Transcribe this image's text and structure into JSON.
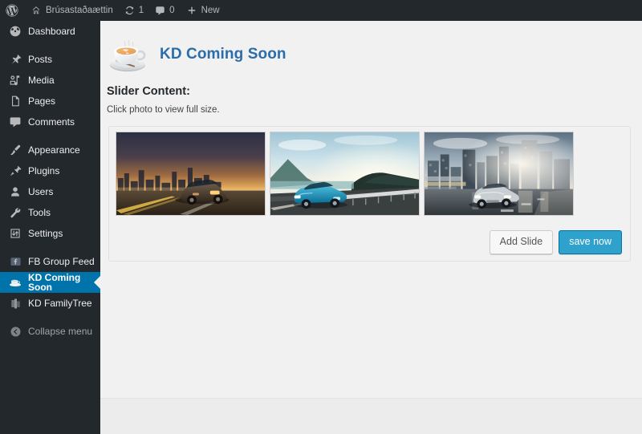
{
  "adminbar": {
    "logo_icon": "wordpress-logo-icon",
    "site_home_icon": "home-icon",
    "site_name": "Brúsastaðaættin",
    "updates_icon": "updates-refresh-icon",
    "updates_count": "1",
    "comments_icon": "comment-bubble-icon",
    "comments_count": "0",
    "new_icon": "plus-icon",
    "new_label": "New"
  },
  "sidebar": {
    "items": [
      {
        "label": "Dashboard",
        "icon": "dashboard-icon",
        "current": false,
        "sep_after": true
      },
      {
        "label": "Posts",
        "icon": "pin-icon",
        "current": false,
        "sep_after": false
      },
      {
        "label": "Media",
        "icon": "media-icon",
        "current": false,
        "sep_after": false
      },
      {
        "label": "Pages",
        "icon": "pages-icon",
        "current": false,
        "sep_after": false
      },
      {
        "label": "Comments",
        "icon": "comment-icon",
        "current": false,
        "sep_after": true
      },
      {
        "label": "Appearance",
        "icon": "paintbrush-icon",
        "current": false,
        "sep_after": false
      },
      {
        "label": "Plugins",
        "icon": "plug-icon",
        "current": false,
        "sep_after": false
      },
      {
        "label": "Users",
        "icon": "user-icon",
        "current": false,
        "sep_after": false
      },
      {
        "label": "Tools",
        "icon": "wrench-icon",
        "current": false,
        "sep_after": false
      },
      {
        "label": "Settings",
        "icon": "settings-icon",
        "current": false,
        "sep_after": true
      },
      {
        "label": "FB Group Feed",
        "icon": "facebook-feed-icon",
        "current": false,
        "sep_after": false
      },
      {
        "label": "KD Coming Soon",
        "icon": "coffee-cup-icon",
        "current": true,
        "sep_after": false
      },
      {
        "label": "KD FamilyTree",
        "icon": "family-tree-icon",
        "current": false,
        "sep_after": false
      }
    ],
    "collapse_label": "Collapse menu",
    "collapse_icon": "collapse-arrow-icon"
  },
  "page": {
    "logo_icon": "coffee-cup-logo-icon",
    "title": "KD Coming Soon",
    "section_heading": "Slider Content:",
    "section_subtext": "Click photo to view full size."
  },
  "slider": {
    "slides": [
      {
        "name": "slide-1",
        "alt": "Brown SUV driving on highway with city skyline at sunset"
      },
      {
        "name": "slide-2",
        "alt": "Blue sports sedan on coastal mountain road at sunrise"
      },
      {
        "name": "slide-3",
        "alt": "Silver sedan on wet city street with skyscrapers and sun flare"
      }
    ],
    "add_slide_label": "Add Slide",
    "save_label": "save now"
  },
  "colors": {
    "admin_bar_bg": "#23282d",
    "menu_bg": "#23282d",
    "menu_current_bg": "#0073aa",
    "content_bg": "#f1f1f1",
    "title_blue": "#2b6cab",
    "primary_button": "#2ea2cc"
  }
}
